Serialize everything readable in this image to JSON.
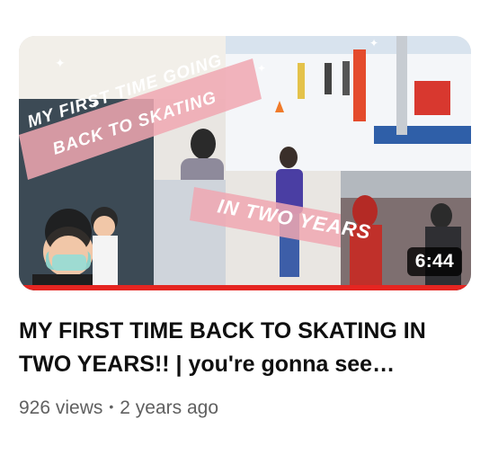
{
  "video": {
    "title": "MY FIRST TIME BACK TO SKATING IN TWO YEARS!! | you're gonna see…",
    "duration": "6:44",
    "views": "926 views",
    "separator": "•",
    "age": "2 years ago",
    "watch_progress": 1.0
  },
  "thumbnail": {
    "caption_line_1": "MY FIRST TIME GOING",
    "caption_line_2": "BACK TO SKATING",
    "caption_line_3": "IN TWO YEARS",
    "progress_color": "#e52521"
  }
}
